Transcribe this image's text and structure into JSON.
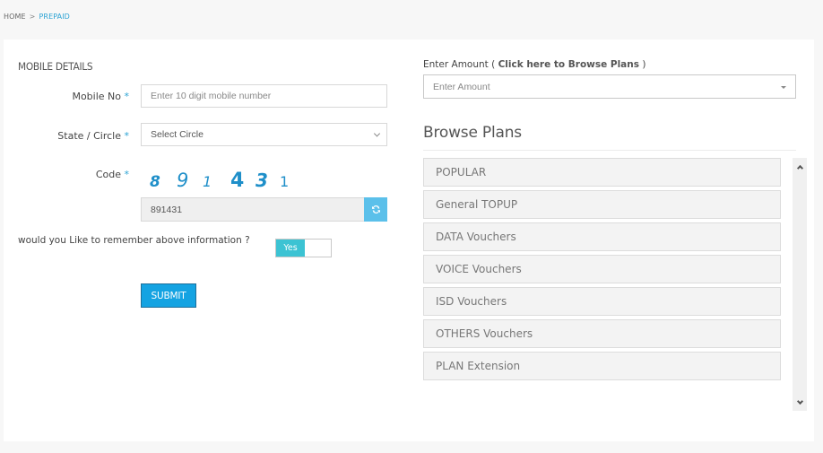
{
  "breadcrumb": {
    "home": "HOME",
    "separator": ">",
    "current": "PREPAID"
  },
  "mobile_details": {
    "title": "MOBILE DETAILS",
    "mobile_no": {
      "label": "Mobile No",
      "required_mark": "*",
      "placeholder": "Enter 10 digit mobile number",
      "value": ""
    },
    "state_circle": {
      "label": "State / Circle",
      "required_mark": "*",
      "selected": "Select Circle"
    },
    "code": {
      "label": "Code",
      "required_mark": "*",
      "captcha_digits": [
        "8",
        "9",
        "1",
        "4",
        "3",
        "1"
      ],
      "value": "891431",
      "refresh_icon": "refresh-icon"
    },
    "remember": {
      "question": "would you Like to remember above information ?",
      "toggle_label": "Yes",
      "toggle_on": true
    },
    "submit_label": "SUBMIT"
  },
  "amount": {
    "label_prefix": "Enter Amount ( ",
    "label_link": "Click here to Browse Plans",
    "label_suffix": " )",
    "placeholder": "Enter Amount",
    "value": ""
  },
  "browse_plans": {
    "title": "Browse Plans",
    "items": [
      {
        "label": "POPULAR"
      },
      {
        "label": "General TOPUP"
      },
      {
        "label": "DATA Vouchers"
      },
      {
        "label": "VOICE Vouchers"
      },
      {
        "label": "ISD Vouchers"
      },
      {
        "label": "OTHERS Vouchers"
      },
      {
        "label": "PLAN Extension"
      }
    ]
  },
  "colors": {
    "accent": "#2ca3d4",
    "submit": "#14a3e2",
    "toggle_on": "#3cc3d3",
    "refresh": "#5bc0ea",
    "captcha": "#1f8fc9"
  }
}
